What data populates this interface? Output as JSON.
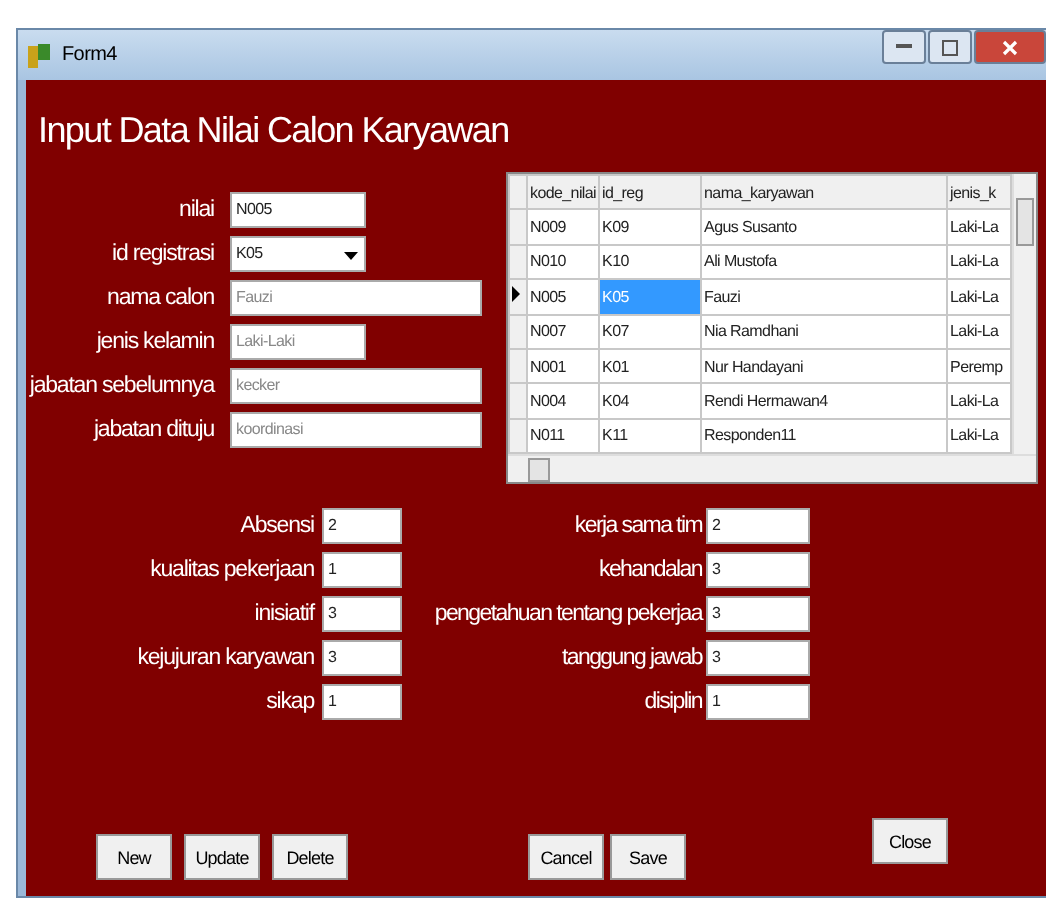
{
  "window": {
    "title": "Form4"
  },
  "heading": "Input Data Nilai Calon Karyawan",
  "fields": [
    {
      "label": "nilai",
      "value": "N005",
      "kind": "text"
    },
    {
      "label": "id registrasi",
      "value": "K05",
      "kind": "combo"
    },
    {
      "label": "nama calon",
      "value": "Fauzi",
      "kind": "text"
    },
    {
      "label": "jenis kelamin",
      "value": "Laki-Laki",
      "kind": "text"
    },
    {
      "label": "jabatan sebelumnya",
      "value": "kecker",
      "kind": "text"
    },
    {
      "label": "jabatan dituju",
      "value": "koordinasi",
      "kind": "text"
    }
  ],
  "table": {
    "columns": [
      "kode_nilai",
      "id_reg",
      "nama_karyawan",
      "jenis_k"
    ],
    "rows": [
      {
        "cells": [
          "N009",
          "K09",
          "Agus Susanto",
          "Laki-La"
        ],
        "selected": false
      },
      {
        "cells": [
          "N010",
          "K10",
          "Ali Mustofa",
          "Laki-La"
        ],
        "selected": false
      },
      {
        "cells": [
          "N005",
          "K05",
          "Fauzi",
          "Laki-La"
        ],
        "selected": true
      },
      {
        "cells": [
          "N007",
          "K07",
          "Nia Ramdhani",
          "Laki-La"
        ],
        "selected": false
      },
      {
        "cells": [
          "N001",
          "K01",
          "Nur Handayani",
          "Peremp"
        ],
        "selected": false
      },
      {
        "cells": [
          "N004",
          "K04",
          "Rendi Hermawan4",
          "Laki-La"
        ],
        "selected": false
      },
      {
        "cells": [
          "N011",
          "K11",
          "Responden11",
          "Laki-La"
        ],
        "selected": false
      }
    ]
  },
  "scores_left": [
    {
      "label": "Absensi",
      "value": "2"
    },
    {
      "label": "kualitas pekerjaan",
      "value": "1"
    },
    {
      "label": "inisiatif",
      "value": "3"
    },
    {
      "label": "kejujuran karyawan",
      "value": "3"
    },
    {
      "label": "sikap",
      "value": "1"
    }
  ],
  "scores_right": [
    {
      "label": "kerja sama tim",
      "value": "2"
    },
    {
      "label": "kehandalan",
      "value": "3"
    },
    {
      "label": "pengetahuan tentang pekerjaa",
      "value": "3"
    },
    {
      "label": "tanggung jawab",
      "value": "3"
    },
    {
      "label": "disiplin",
      "value": "1"
    }
  ],
  "buttons_left": [
    "New",
    "Update",
    "Delete"
  ],
  "buttons_middle": [
    "Cancel",
    "Save"
  ],
  "close_button": "Close"
}
